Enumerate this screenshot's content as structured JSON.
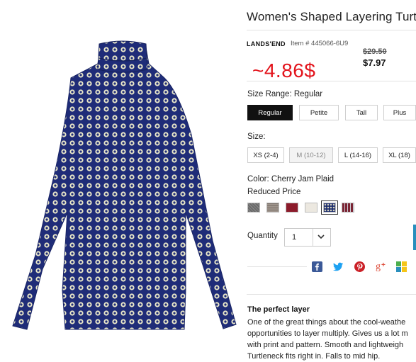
{
  "product": {
    "title": "Women's Shaped Layering Turt",
    "brand": "LANDS'END",
    "item_number": "Item # 445066-6U9",
    "original_price": "$29.50",
    "sale_price": "$7.97",
    "overlay_price": "~4.86$"
  },
  "size_range": {
    "label": "Size Range: Regular",
    "options": [
      "Regular",
      "Petite",
      "Tall",
      "Plus"
    ],
    "selected": "Regular"
  },
  "size": {
    "label": "Size:",
    "options": [
      "XS (2-4)",
      "M (10-12)",
      "L (14-16)",
      "XL (18)"
    ],
    "unavailable": [
      "M (10-12)"
    ]
  },
  "color": {
    "label": "Color: Cherry Jam Plaid",
    "price_note": "Reduced Price",
    "swatch_colors": [
      "#6a6a6a",
      "#c9c2bd",
      "#8c1b2b",
      "#ece8e0",
      "#1e2f6e",
      "#7a2433"
    ]
  },
  "quantity": {
    "label": "Quantity",
    "value": "1"
  },
  "social_icons": [
    "facebook-icon",
    "twitter-icon",
    "pinterest-icon",
    "google-plus-icon",
    "fancy-icon"
  ],
  "description": {
    "heading": "The perfect layer",
    "lines": [
      "One of the great things about the cool-weathe",
      "opportunities to layer multiply. Gives us a lot m",
      "with print and pattern. Smooth and lightweigh",
      "Turtleneck fits right in. Falls to mid hip."
    ]
  }
}
